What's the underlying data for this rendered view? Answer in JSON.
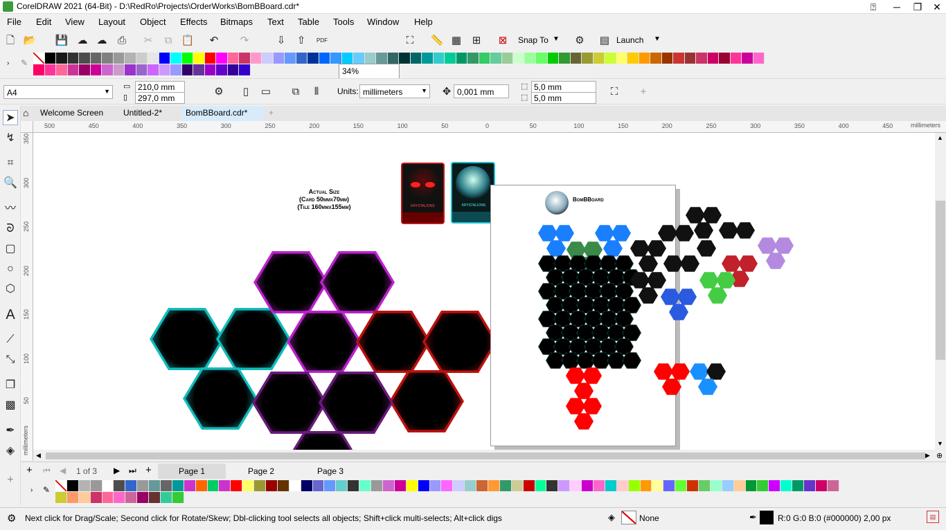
{
  "window": {
    "title": "CorelDRAW 2021 (64-Bit) - D:\\RedRo\\Projects\\OrderWorks\\BomBBoard.cdr*"
  },
  "menu": [
    "File",
    "Edit",
    "View",
    "Layout",
    "Object",
    "Effects",
    "Bitmaps",
    "Text",
    "Table",
    "Tools",
    "Window",
    "Help"
  ],
  "toolbar": {
    "zoom": "34%",
    "snap_to": "Snap To",
    "launch": "Launch",
    "pdf": "PDF"
  },
  "property_bar": {
    "page_size": "A4",
    "width": "210,0 mm",
    "height": "297,0 mm",
    "units_label": "Units:",
    "units": "millimeters",
    "nudge": "0,001 mm",
    "dup_x": "5,0 mm",
    "dup_y": "5,0 mm"
  },
  "doc_tabs": [
    "Welcome Screen",
    "Untitled-2*",
    "BomBBoard.cdr*"
  ],
  "ruler": {
    "h_ticks": [
      "500",
      "450",
      "400",
      "350",
      "300",
      "250",
      "200",
      "150",
      "100",
      "50",
      "0",
      "50",
      "100",
      "150",
      "200",
      "250",
      "300",
      "350",
      "400",
      "450"
    ],
    "h_unit": "millimeters",
    "v_ticks": [
      "350",
      "300",
      "250",
      "200",
      "150",
      "100",
      "50"
    ],
    "v_unit": "millimeters"
  },
  "canvas": {
    "size_note_line1": "Actual Size",
    "size_note_line2": "(Card 50mmx70mm)",
    "size_note_line3": "(Tile 160mmx155mm)",
    "card1_label": "KRYSTALIONS",
    "card2_label": "KRYSTALIONS",
    "sheet_title": "BomBBoard"
  },
  "page_nav": {
    "current": "1",
    "of": "of",
    "total": "3",
    "pages": [
      "Page 1",
      "Page 2",
      "Page 3"
    ]
  },
  "status": {
    "hint": "Next click for Drag/Scale; Second click for Rotate/Skew; Dbl-clicking tool selects all objects; Shift+click multi-selects; Alt+click digs",
    "fill": "None",
    "outline": "R:0 G:0 B:0 (#000000)  2,00 px"
  },
  "colors": {
    "top_palette_row1": [
      "#ffffff",
      "#000000",
      "#1a1a1a",
      "#333333",
      "#4d4d4d",
      "#666666",
      "#808080",
      "#999999",
      "#b3b3b3",
      "#cccccc",
      "#e6e6e6",
      "#0000ff",
      "#00ffff",
      "#00ff00",
      "#ffff00",
      "#ff0000",
      "#ff00ff",
      "#ff6699",
      "#cc3366",
      "#ff99cc",
      "#ccccff",
      "#9999ff",
      "#6699ff",
      "#3366cc",
      "#003399",
      "#0066ff",
      "#3399ff",
      "#00ccff",
      "#66ccff",
      "#99cccc",
      "#669999",
      "#336666",
      "#003333",
      "#006666",
      "#009999",
      "#33cccc",
      "#00cc99",
      "#009966",
      "#339966",
      "#33cc66",
      "#66cc99",
      "#99cc99",
      "#ccffcc",
      "#99ff99",
      "#66ff66",
      "#00cc00",
      "#339933",
      "#666633",
      "#999933",
      "#cccc33",
      "#ccff33",
      "#ffff66",
      "#ffcc00",
      "#ff9900",
      "#cc6600",
      "#993300",
      "#cc3333",
      "#993333",
      "#cc3366",
      "#cc0066",
      "#990033",
      "#ff3399",
      "#cc0099",
      "#ff66cc"
    ],
    "top_palette_row2": [
      "#ff0066",
      "#ff3399",
      "#ff6699",
      "#cc3399",
      "#990066",
      "#cc0099",
      "#cc66cc",
      "#cc99cc",
      "#9933cc",
      "#9966cc",
      "#cc66ff",
      "#cc99ff",
      "#9999ff",
      "#330066",
      "#663399",
      "#9900cc",
      "#6600cc",
      "#330099",
      "#3300cc"
    ],
    "bottom_palette_row1": [
      "#ffffff",
      "#000000",
      "#b3b3b3",
      "#999999",
      "#ffffff",
      "#4d4d4d",
      "#3366cc",
      "#999999",
      "#669999",
      "#666666",
      "#009999",
      "#cc33cc",
      "#ff6600",
      "#00cc66",
      "#cc33cc",
      "#ff0000",
      "#ffff66",
      "#999933",
      "#990000",
      "#663300",
      "#ffffff",
      "#000066",
      "#6666cc",
      "#6699ff",
      "#66cccc",
      "#333333",
      "#66ffcc",
      "#999999",
      "#cc66cc",
      "#cc0099",
      "#ffff00",
      "#0000ff",
      "#9999ff",
      "#ff66ff",
      "#ccccff",
      "#99cccc",
      "#cc6633",
      "#ff9933",
      "#339966",
      "#cccc99",
      "#cc0000",
      "#00ff99",
      "#333333",
      "#cc99ff",
      "#ffccff",
      "#cc00cc",
      "#ff66cc",
      "#00cccc",
      "#ffcccc",
      "#99ff00",
      "#ff9900",
      "#ffff99",
      "#6666ff",
      "#66ff33",
      "#cc3300",
      "#66cc66",
      "#99ffcc",
      "#99ccff",
      "#ffcc99",
      "#009933",
      "#33cc33",
      "#cc00ff",
      "#00ffcc",
      "#009966",
      "#6633cc",
      "#cc0066",
      "#cc6699"
    ],
    "bottom_palette_row2": [
      "#cccc33",
      "#ff9966",
      "#ffcc99",
      "#cc3366",
      "#ff6699",
      "#ff66cc",
      "#cc6699",
      "#990066",
      "#663333",
      "#33cc99",
      "#33cc33"
    ]
  }
}
